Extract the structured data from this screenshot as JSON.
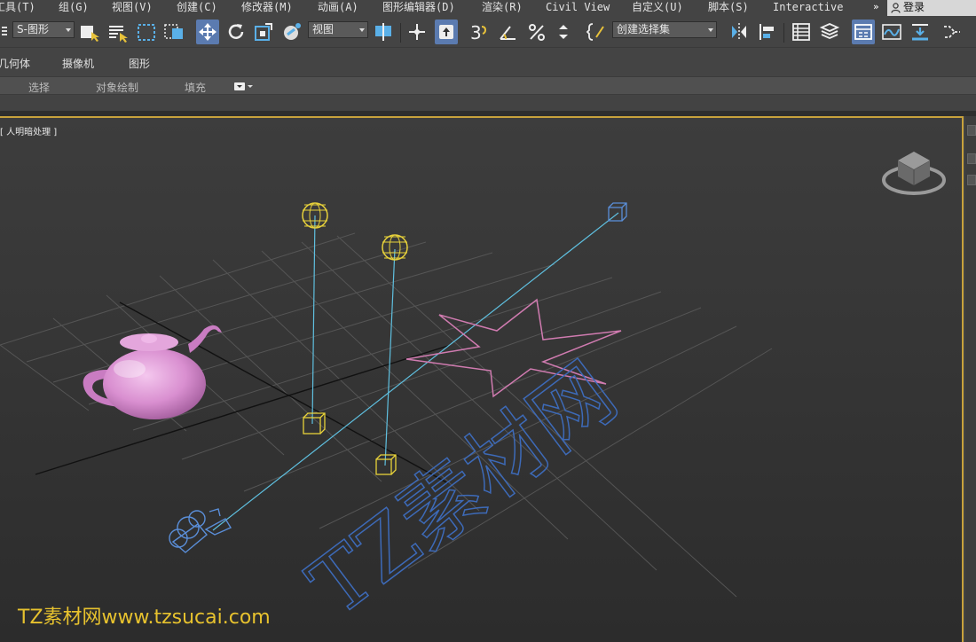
{
  "menubar": {
    "items": [
      "工具(T)",
      "组(G)",
      "视图(V)",
      "创建(C)",
      "修改器(M)",
      "动画(A)",
      "图形编辑器(D)",
      "渲染(R)",
      "Civil View",
      "自定义(U)",
      "脚本(S)",
      "Interactive"
    ],
    "more": "»",
    "login": "登录"
  },
  "toolbar": {
    "selection_filter": "S-图形",
    "ref_coord": "视图",
    "selection_set": "创建选择集",
    "snap_label": "3"
  },
  "ribbon": {
    "tabs": [
      "几何体",
      "摄像机",
      "图形"
    ],
    "sub_tabs": [
      "选择",
      "对象绘制",
      "填充"
    ]
  },
  "viewport": {
    "label": "[ 人明暗处理 ]",
    "border_color": "#c8a23c",
    "overlay_text": "TZ素材网"
  },
  "colors": {
    "teapot": "#d98fd0",
    "light": "#e8d23a",
    "camera": "#5a8ed8",
    "star": "#d07bb0",
    "text_spline": "#3d6ab8",
    "target_line": "#5fc0e0"
  },
  "watermark": "TZ素材网www.tzsucai.com"
}
